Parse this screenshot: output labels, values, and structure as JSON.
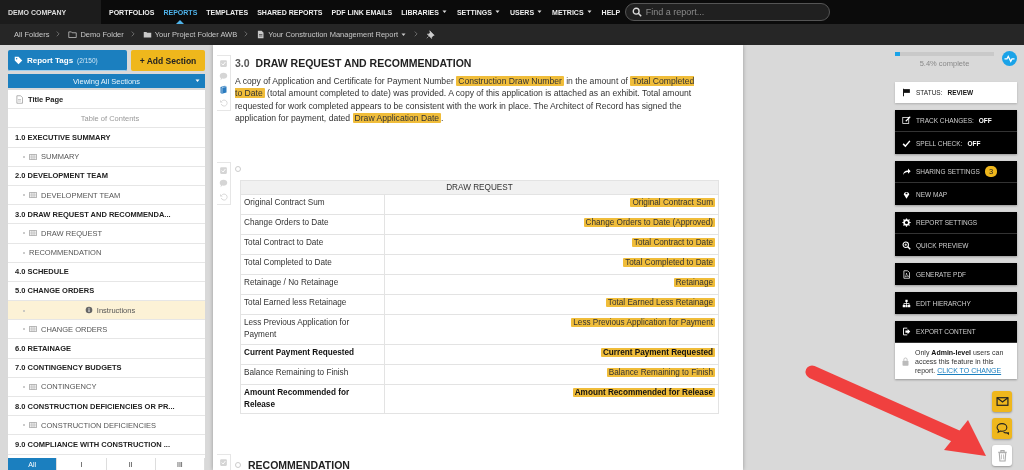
{
  "brand": "DEMO COMPANY",
  "nav": [
    {
      "label": "PORTFOLIOS",
      "selected": false,
      "has_menu": false
    },
    {
      "label": "REPORTS",
      "selected": true,
      "has_menu": false
    },
    {
      "label": "TEMPLATES",
      "selected": false,
      "has_menu": false
    },
    {
      "label": "SHARED REPORTS",
      "selected": false,
      "has_menu": false
    },
    {
      "label": "PDF LINK EMAILS",
      "selected": false,
      "has_menu": false
    },
    {
      "label": "LIBRARIES",
      "selected": false,
      "has_menu": true
    },
    {
      "label": "SETTINGS",
      "selected": false,
      "has_menu": true
    },
    {
      "label": "USERS",
      "selected": false,
      "has_menu": true
    },
    {
      "label": "METRICS",
      "selected": false,
      "has_menu": true
    },
    {
      "label": "HELP",
      "selected": false,
      "has_menu": false
    }
  ],
  "search": {
    "placeholder": "Find a report..."
  },
  "breadcrumbs": [
    {
      "label": "All Folders",
      "kind": "plain"
    },
    {
      "label": "Demo Folder",
      "kind": "folder"
    },
    {
      "label": "Your Project Folder AWB",
      "kind": "folder-filled"
    },
    {
      "label": "Your Construction Management Report",
      "kind": "report"
    }
  ],
  "sidebar": {
    "tags_button": {
      "label": "Report Tags",
      "count": "(2/150)"
    },
    "add_button": "+ Add Section",
    "view_select": "Viewing All Sections",
    "items": [
      {
        "kind": "title",
        "label": "Title Page"
      },
      {
        "kind": "toc",
        "label": "Table of Contents"
      },
      {
        "kind": "section",
        "label": "1.0 EXECUTIVE SUMMARY"
      },
      {
        "kind": "table",
        "label": "SUMMARY"
      },
      {
        "kind": "section",
        "label": "2.0 DEVELOPMENT TEAM"
      },
      {
        "kind": "table",
        "label": "DEVELOPMENT TEAM"
      },
      {
        "kind": "section",
        "label": "3.0 DRAW REQUEST AND RECOMMENDA..."
      },
      {
        "kind": "table",
        "label": "DRAW REQUEST"
      },
      {
        "kind": "text",
        "label": "RECOMMENDATION"
      },
      {
        "kind": "section",
        "label": "4.0 SCHEDULE"
      },
      {
        "kind": "section",
        "label": "5.0 CHANGE ORDERS"
      },
      {
        "kind": "instructions",
        "label": "Instructions"
      },
      {
        "kind": "table",
        "label": "CHANGE ORDERS"
      },
      {
        "kind": "section",
        "label": "6.0 RETAINAGE"
      },
      {
        "kind": "section",
        "label": "7.0 CONTINGENCY BUDGETS"
      },
      {
        "kind": "table",
        "label": "CONTINGENCY"
      },
      {
        "kind": "section",
        "label": "8.0 CONSTRUCTION DEFICIENCIES OR PR..."
      },
      {
        "kind": "table",
        "label": "CONSTRUCTION DEFICIENCIES"
      },
      {
        "kind": "section",
        "label": "9.0 COMPLIANCE WITH CONSTRUCTION ..."
      }
    ],
    "filter_tabs": [
      {
        "label": "All",
        "selected": true
      },
      {
        "label": "I",
        "selected": false
      },
      {
        "label": "II",
        "selected": false
      },
      {
        "label": "III",
        "selected": false
      }
    ]
  },
  "document": {
    "number": "3.0",
    "title": "DRAW REQUEST AND RECOMMENDATION",
    "paragraph": [
      {
        "text": "A copy of Application and Certificate for Payment Number ",
        "field": false
      },
      {
        "text": "Construction Draw Number",
        "field": true
      },
      {
        "text": " in the amount of ",
        "field": false
      },
      {
        "text": "Total Completed to Date",
        "field": true
      },
      {
        "text": " (total amount completed to date) was provided. A copy of this application is attached as an exhibit. Total amount requested for work completed appears to be consistent with the work in place. The Architect of Record has signed the application for payment, dated ",
        "field": false
      },
      {
        "text": "Draw Application Date",
        "field": true
      },
      {
        "text": ".",
        "field": false
      }
    ],
    "table": {
      "title": "DRAW REQUEST",
      "rows": [
        {
          "label": "Original Contract Sum",
          "value": "Original Contract Sum",
          "bold": false
        },
        {
          "label": "Change Orders to Date",
          "value": "Change Orders to Date (Approved)",
          "bold": false
        },
        {
          "label": "Total Contract to Date",
          "value": "Total Contract to Date",
          "bold": false
        },
        {
          "label": "Total Completed to Date",
          "value": "Total Completed to Date",
          "bold": false
        },
        {
          "label": "Retainage / No Retainage",
          "value": "Retainage",
          "bold": false
        },
        {
          "label": "Total Earned less Retainage",
          "value": "Total Earned Less Retainage",
          "bold": false
        },
        {
          "label": "Less Previous Application for Payment",
          "value": "Less Previous Application for Payment",
          "bold": false
        },
        {
          "label": "Current Payment Requested",
          "value": "Current Payment Requested",
          "bold": true
        },
        {
          "label": "Balance Remaining to Finish",
          "value": "Balance Remaining to Finish",
          "bold": false
        },
        {
          "label": "Amount Recommended for Release",
          "value": "Amount Recommended for Release",
          "bold": true
        }
      ]
    },
    "next_heading": "RECOMMENDATION"
  },
  "progress": {
    "level": 0.054,
    "label": "5.4% complete"
  },
  "status": {
    "label": "STATUS:",
    "value": "REVIEW"
  },
  "action_groups": [
    [
      {
        "kind": "edit",
        "label": "TRACK CHANGES:",
        "value": "OFF"
      },
      {
        "kind": "check",
        "label": "SPELL CHECK:",
        "value": "OFF"
      }
    ],
    [
      {
        "kind": "share",
        "label": "SHARING SETTINGS",
        "badge": "3"
      },
      {
        "kind": "pin",
        "label": "NEW MAP"
      }
    ],
    [
      {
        "kind": "gear",
        "label": "REPORT SETTINGS"
      },
      {
        "kind": "zoom",
        "label": "QUICK PREVIEW"
      }
    ],
    [
      {
        "kind": "pdf",
        "label": "GENERATE PDF"
      }
    ],
    [
      {
        "kind": "hierarchy",
        "label": "EDIT HIERARCHY"
      }
    ],
    [
      {
        "kind": "export",
        "label": "EXPORT CONTENT"
      }
    ]
  ],
  "export_note": {
    "text": "Only **Admin-level** users can access this feature in this report.",
    "link": "CLICK TO CHANGE"
  }
}
